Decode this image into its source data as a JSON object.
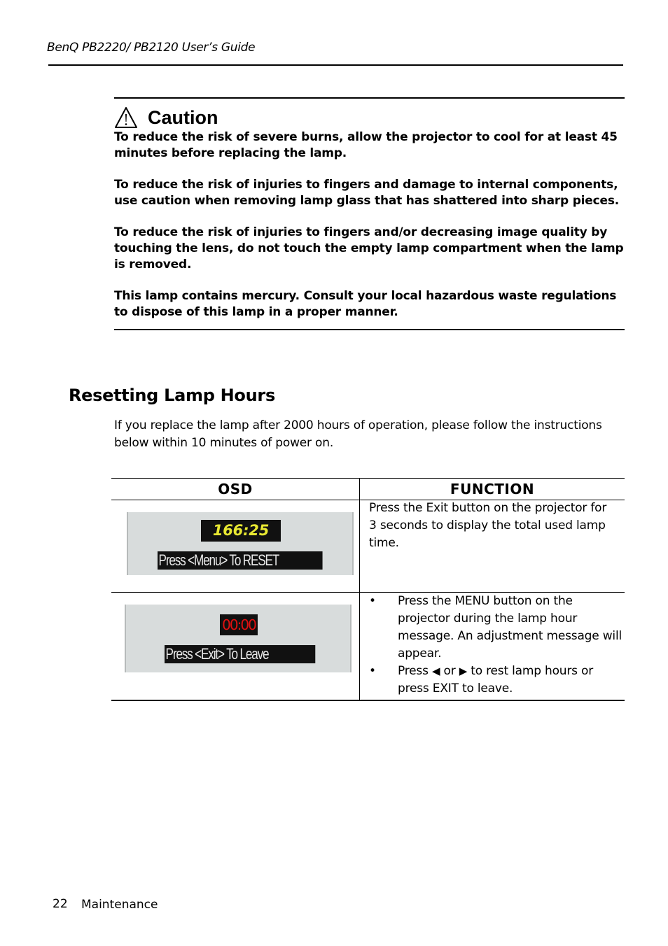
{
  "header": {
    "title": "BenQ PB2220/ PB2120 User’s Guide"
  },
  "caution": {
    "icon": "warning-triangle-icon",
    "title": "Caution",
    "paragraphs": [
      "To reduce the risk of severe burns, allow the projector to cool for at least 45 minutes before replacing the lamp.",
      "To reduce the risk of injuries to fingers and damage to internal components, use caution when removing lamp glass that has shattered into sharp pieces.",
      "To reduce the risk of injuries to fingers and/or decreasing image quality by touching the lens, do not touch the empty lamp compartment when the lamp is removed.",
      "This lamp contains mercury. Consult your local hazardous waste regulations to dispose of this lamp in a proper manner."
    ]
  },
  "section": {
    "title": "Resetting Lamp Hours",
    "intro": "If you replace the lamp after 2000 hours of operation, please follow the instructions below within 10 minutes of power on."
  },
  "table": {
    "headers": [
      "OSD",
      "FUNCTION"
    ],
    "rows": [
      {
        "osd": {
          "time": "166:25",
          "time_color": "#e8e832",
          "message": "Press <Menu> To RESET"
        },
        "function": "Press the Exit button on the projector for 3 seconds to display the total used lamp time."
      },
      {
        "osd": {
          "time": "00:00",
          "time_color": "#e01010",
          "message": "Press <Exit>  To Leave"
        },
        "function_list": [
          {
            "bullet": "•",
            "text": "Press the MENU button on the projector during the lamp hour message. An adjustment message will appear."
          },
          {
            "bullet": "•",
            "text_before": "Press ",
            "left_arrow": "◀",
            "text_mid": " or ",
            "right_arrow": "▶",
            "text_after": " to rest lamp hours or press EXIT to leave."
          }
        ]
      }
    ]
  },
  "footer": {
    "page_number": "22",
    "section": "Maintenance"
  }
}
